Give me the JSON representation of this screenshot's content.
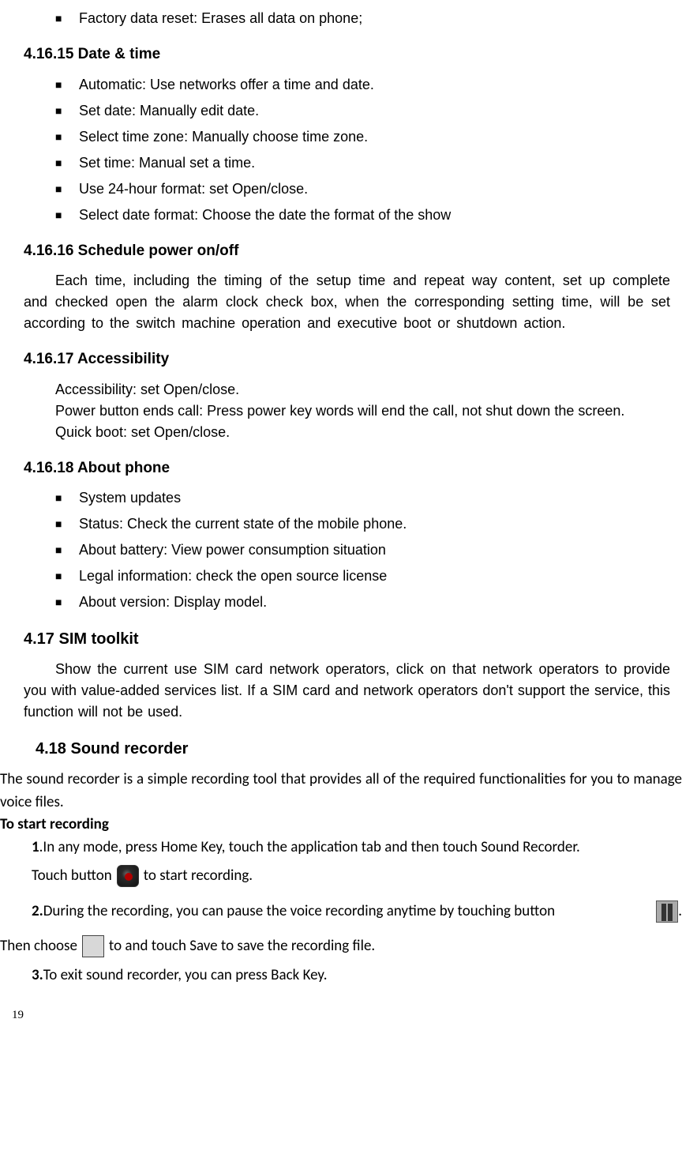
{
  "intro_bullet": "Factory data reset: Erases all data on phone;",
  "sec_4_16_15": {
    "title": "4.16.15  Date & time",
    "items": [
      "Automatic: Use networks offer a time and date.",
      "Set date: Manually edit date.",
      "Select time zone: Manually choose time zone.",
      "Set time: Manual set a time.",
      "Use 24-hour format: set Open/close.",
      "Select date format: Choose the date the format of the show"
    ]
  },
  "sec_4_16_16": {
    "title": "4.16.16  Schedule power on/off",
    "body": "Each time, including the timing of the setup time and repeat way content, set up complete and checked open the alarm clock check box, when the corresponding setting time, will be set according to the switch machine operation and executive boot or shutdown action."
  },
  "sec_4_16_17": {
    "title": "4.16.17  Accessibility",
    "p1": "Accessibility: set Open/close.",
    "p2": "Power button ends call: Press power key words will end the call, not shut down the screen.",
    "p3": "Quick boot: set Open/close."
  },
  "sec_4_16_18": {
    "title": "4.16.18  About phone",
    "items": [
      "System updates",
      "Status: Check the current state of the mobile phone.",
      "About battery: View power consumption situation",
      "Legal information: check the open source license",
      "About version: Display model."
    ]
  },
  "sec_4_17": {
    "title": "4.17 SIM toolkit",
    "body": "Show the current use SIM card network operators, click on that network operators to provide you with value-added services list. If a SIM card and network operators don't support the service, this function will not be used."
  },
  "sec_4_18": {
    "title": "4.18 Sound recorder",
    "intro": "The sound recorder is a simple recording tool that provides all of the required functionalities for you to manage voice files.",
    "to_start": "To start recording",
    "s1_num": "1",
    "s1_text": ".In any mode, press Home Key, touch the application tab and then touch Sound Recorder.",
    "s1b_pre": "Touch button ",
    "s1b_post": " to start recording.",
    "s2_num": "2.",
    "s2_text": "During the recording, you can pause the voice recording anytime by touching button",
    "s2_end": ".",
    "s2b_pre": "Then choose ",
    "s2b_post": " to and touch Save to save the recording file.",
    "s3_num": "3.",
    "s3_text": "To exit sound recorder, you can press Back Key."
  },
  "page_number": "19"
}
